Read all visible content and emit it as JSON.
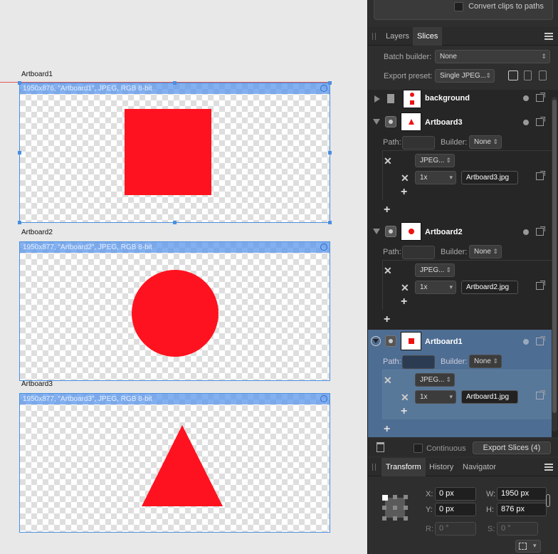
{
  "canvas": {
    "artboards": [
      {
        "label": "Artboard1",
        "slice_info": "1950x876, \"Artboard1\", JPEG, RGB 8-bit",
        "shape": "square",
        "fill": "#ff121f"
      },
      {
        "label": "Artboard2",
        "slice_info": "1950x877, \"Artboard2\", JPEG, RGB 8-bit",
        "shape": "circle",
        "fill": "#ff121f"
      },
      {
        "label": "Artboard3",
        "slice_info": "1950x877, \"Artboard3\", JPEG, RGB 8-bit",
        "shape": "triangle",
        "fill": "#ff121f"
      }
    ]
  },
  "top_panel": {
    "convert_clips_label": "Convert clips to paths"
  },
  "slices_panel": {
    "tabs": [
      "Layers",
      "Slices"
    ],
    "active_tab": "Slices",
    "batch_builder_label": "Batch builder:",
    "batch_builder_value": "None",
    "export_preset_label": "Export preset:",
    "export_preset_value": "Single JPEG...",
    "items": [
      {
        "name": "background"
      },
      {
        "name": "Artboard3",
        "path_label": "Path:",
        "builder_label": "Builder:",
        "builder_value": "None",
        "format": "JPEG...",
        "scale": "1x",
        "filename": "Artboard3.jpg"
      },
      {
        "name": "Artboard2",
        "path_label": "Path:",
        "builder_label": "Builder:",
        "builder_value": "None",
        "format": "JPEG...",
        "scale": "1x",
        "filename": "Artboard2.jpg"
      },
      {
        "name": "Artboard1",
        "path_label": "Path:",
        "builder_label": "Builder:",
        "builder_value": "None",
        "format": "JPEG...",
        "scale": "1x",
        "filename": "Artboard1.jpg"
      }
    ],
    "continuous_label": "Continuous",
    "export_button": "Export Slices (4)"
  },
  "transform_panel": {
    "tabs": [
      "Transform",
      "History",
      "Navigator"
    ],
    "active_tab": "Transform",
    "x_label": "X:",
    "x_value": "0 px",
    "y_label": "Y:",
    "y_value": "0 px",
    "w_label": "W:",
    "w_value": "1950 px",
    "h_label": "H:",
    "h_value": "876 px",
    "r_label": "R:",
    "r_value": "0 °",
    "s_label": "S:",
    "s_value": "0 °"
  }
}
